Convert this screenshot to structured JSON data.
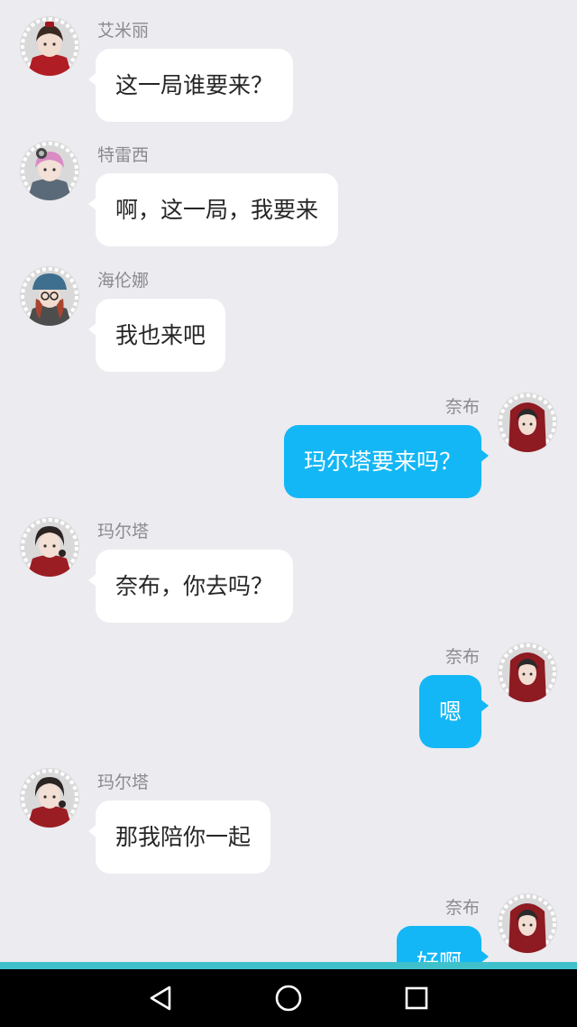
{
  "colors": {
    "background": "#ebebf0",
    "incoming_bubble": "#ffffff",
    "outgoing_bubble": "#14b7f5",
    "name_text": "#8a8a8f",
    "nav_bar": "#000000",
    "bottom_accent": "#3fc1cc"
  },
  "messages": [
    {
      "side": "left",
      "sender": "艾米丽",
      "text": "这一局谁要来？",
      "avatar_icon": "emily-avatar-icon"
    },
    {
      "side": "left",
      "sender": "特雷西",
      "text": "啊，这一局，我要来",
      "avatar_icon": "tracy-avatar-icon"
    },
    {
      "side": "left",
      "sender": "海伦娜",
      "text": "我也来吧",
      "avatar_icon": "helena-avatar-icon"
    },
    {
      "side": "right",
      "sender": "奈布",
      "text": "玛尔塔要来吗？",
      "avatar_icon": "naib-avatar-icon"
    },
    {
      "side": "left",
      "sender": "玛尔塔",
      "text": "奈布，你去吗？",
      "avatar_icon": "martha-avatar-icon"
    },
    {
      "side": "right",
      "sender": "奈布",
      "text": "嗯",
      "avatar_icon": "naib-avatar-icon"
    },
    {
      "side": "left",
      "sender": "玛尔塔",
      "text": "那我陪你一起",
      "avatar_icon": "martha-avatar-icon"
    },
    {
      "side": "right",
      "sender": "奈布",
      "text": "好啊",
      "avatar_icon": "naib-avatar-icon"
    }
  ],
  "nav": {
    "back_icon": "back-triangle-icon",
    "home_icon": "home-circle-icon",
    "recents_icon": "recents-square-icon"
  }
}
